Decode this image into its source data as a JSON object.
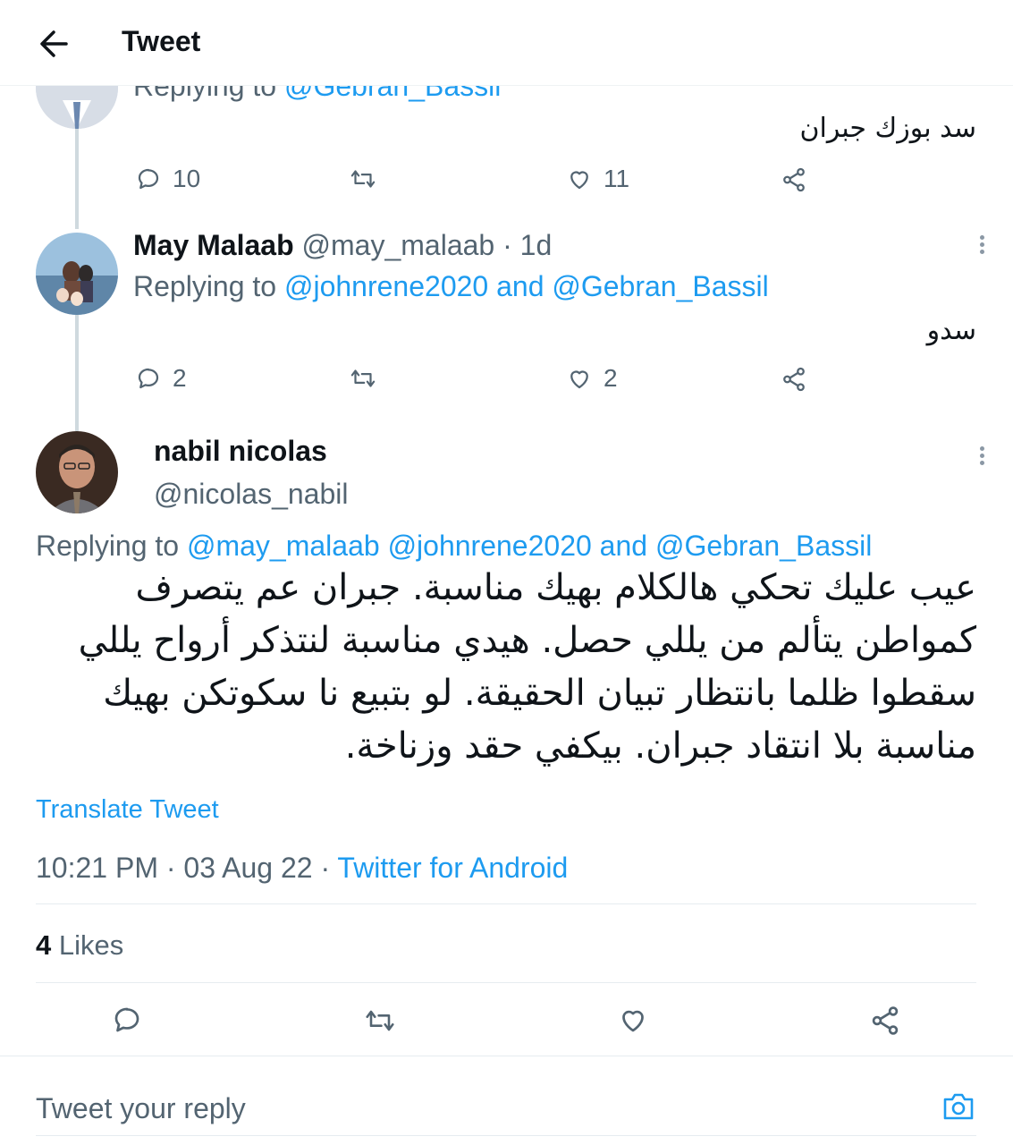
{
  "header": {
    "title": "Tweet"
  },
  "tweets": [
    {
      "display_name": "",
      "handle": "",
      "time": "",
      "replying_prefix": "Replying to",
      "mentions": [
        "@Gebran_Bassil"
      ],
      "text": "سد بوزك جبران",
      "stats": {
        "replies": "10",
        "retweets": "",
        "likes": "11"
      }
    },
    {
      "display_name": "May Malaab",
      "handle": "@may_malaab",
      "time": "· 1d",
      "replying_prefix": "Replying to",
      "mentions": [
        "@johnrene2020",
        "@Gebran_Bassil"
      ],
      "mention_joiner": "and",
      "text": "سدو",
      "stats": {
        "replies": "2",
        "retweets": "",
        "likes": "2"
      }
    }
  ],
  "main_tweet": {
    "display_name": "nabil nicolas",
    "handle": "@nicolas_nabil",
    "replying_prefix": "Replying to",
    "mentions": [
      "@may_malaab",
      "@johnrene2020",
      "@Gebran_Bassil"
    ],
    "mention_joiner": "and",
    "text_lines": [
      "عيب عليك تحكي هالكلام بهيك مناسبة. جبران عم يتصرف",
      "كمواطن يتألم من يللي حصل. هيدي مناسبة لنتذكر أرواح يللي",
      "سقطوا ظلما بانتظار تبيان الحقيقة. لو بتبيع نا سكوتكن بهيك",
      "مناسبة بلا انتقاد جبران. بيكفي حقد وزناخة."
    ],
    "translate_label": "Translate Tweet",
    "timestamp": "10:21 PM · 03 Aug 22 ·",
    "source": "Twitter for Android",
    "likes_count": "4",
    "likes_label": "Likes"
  },
  "reply_bar": {
    "placeholder": "Tweet your reply"
  },
  "icons": {
    "back": "arrow-left-icon",
    "reply": "reply-icon",
    "retweet": "retweet-icon",
    "like": "heart-icon",
    "share": "share-icon",
    "more": "more-vertical-icon",
    "camera": "camera-icon"
  },
  "colors": {
    "accent": "#1d9bf0",
    "secondary_text": "#536471",
    "primary_text": "#0f1419",
    "thread_line": "#cfd9de"
  }
}
